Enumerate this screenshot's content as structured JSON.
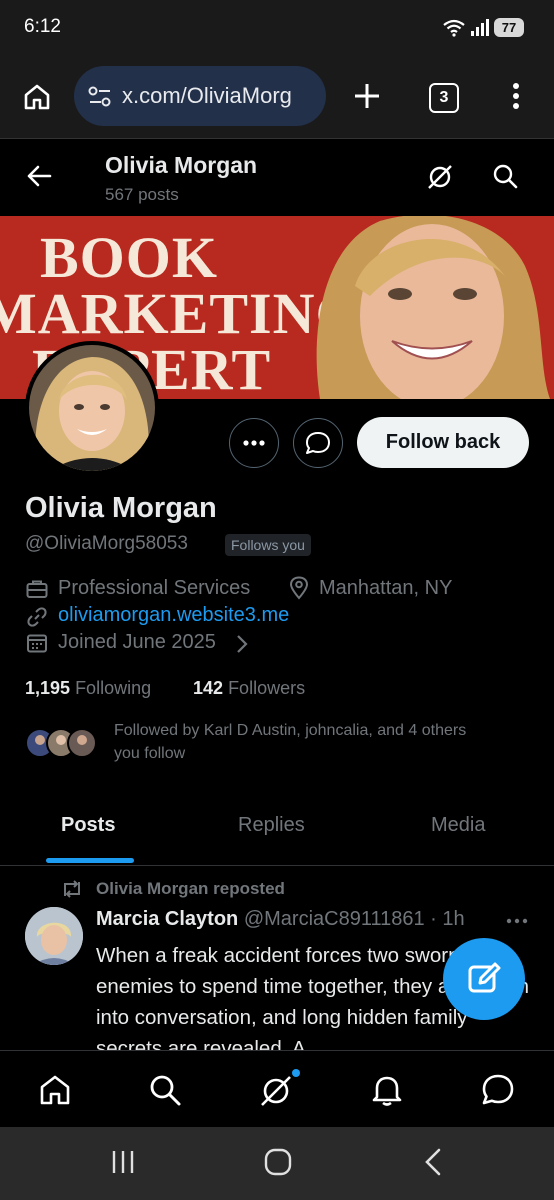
{
  "status_bar": {
    "time": "6:12",
    "battery": "77"
  },
  "browser": {
    "url": "x.com/OliviaMorg",
    "tab_count": "3"
  },
  "profile_header": {
    "title": "Olivia Morgan",
    "post_count": "567 posts"
  },
  "banner": {
    "line1": "BOOK",
    "line2": "MARKETING",
    "line3": "EXPERT"
  },
  "actions": {
    "follow_back": "Follow back"
  },
  "profile": {
    "name": "Olivia Morgan",
    "handle": "@OliviaMorg58053",
    "follows_you": "Follows you",
    "category": "Professional Services",
    "location": "Manhattan, NY",
    "website": "oliviamorgan.website3.me",
    "joined": "Joined June 2025",
    "following_count": "1,195",
    "following_label": "Following",
    "followers_count": "142",
    "followers_label": "Followers",
    "followed_by": "Followed by Karl D Austin, johncalia, and 4 others you follow"
  },
  "tabs": [
    {
      "label": "Posts",
      "active": true
    },
    {
      "label": "Replies",
      "active": false
    },
    {
      "label": "Media",
      "active": false
    }
  ],
  "post": {
    "repost_label": "Olivia Morgan reposted",
    "author": "Marcia Clayton",
    "handle": "@MarciaC89111861 · 1h",
    "text": "When a freak accident forces two sworn enemies to spend time together, they are drawn into conversation, and long hidden family secrets are revealed. A"
  },
  "colors": {
    "accent": "#1d9bf0",
    "banner": "#b8291f",
    "url_bar": "#22304a"
  }
}
